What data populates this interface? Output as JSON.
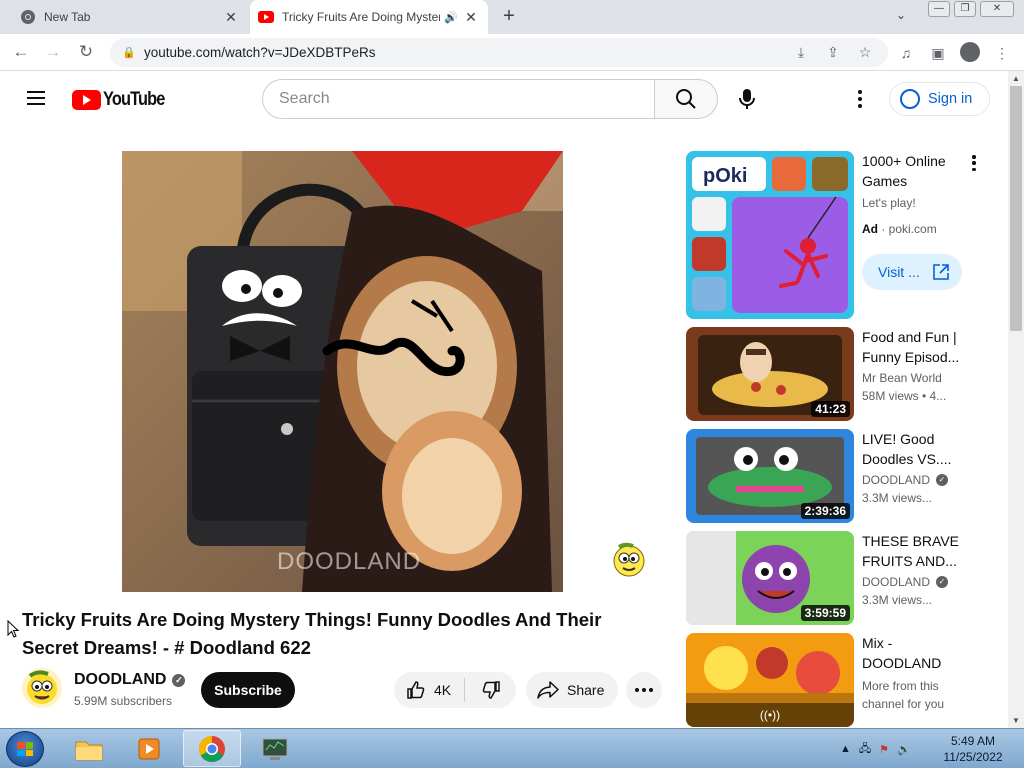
{
  "browser": {
    "tabs": [
      {
        "title": "New Tab"
      },
      {
        "title": "Tricky Fruits Are Doing Mystery Things! Funny Doodles And Their Secret Dreams!"
      }
    ],
    "new_tab": "+",
    "url": "youtube.com/watch?v=JDeXDBTPeRs"
  },
  "youtube": {
    "logo_text": "YouTube",
    "search_placeholder": "Search",
    "sign_in": "Sign in"
  },
  "video": {
    "watermark": "DOODLAND",
    "title": "Tricky Fruits Are Doing Mystery Things! Funny Doodles And Their Secret Dreams! - # Doodland 622",
    "channel": "DOODLAND",
    "subscribers": "5.99M subscribers",
    "subscribe_label": "Subscribe",
    "likes": "4K",
    "share_label": "Share"
  },
  "sidebar": {
    "ad": {
      "title": "1000+ Online Games",
      "description": "Let's play!",
      "badge": "Ad",
      "domain": "poki.com",
      "button": "Visit ...",
      "brand": "pOki"
    },
    "videos": [
      {
        "title": "Food and Fun | Funny Episod...",
        "channel": "Mr Bean World",
        "meta": "58M views  •  4...",
        "duration": "41:23",
        "verified": false
      },
      {
        "title": "LIVE! Good Doodles VS....",
        "channel": "DOODLAND",
        "meta": "3.3M views...",
        "duration": "2:39:36",
        "verified": true
      },
      {
        "title": "THESE BRAVE FRUITS AND...",
        "channel": "DOODLAND",
        "meta": "3.3M views...",
        "duration": "3:59:59",
        "verified": true
      },
      {
        "title": "Mix - DOODLAND",
        "channel": "",
        "meta": "More from this channel for you",
        "duration": "",
        "live_icon": "((•))"
      }
    ]
  },
  "taskbar": {
    "time": "5:49 AM",
    "date": "11/25/2022"
  },
  "colors": {
    "youtube_red": "#ff0000",
    "link_blue": "#065fd4",
    "chrome_frame": "#dee1e6",
    "taskbar": "#8fb4d8"
  }
}
